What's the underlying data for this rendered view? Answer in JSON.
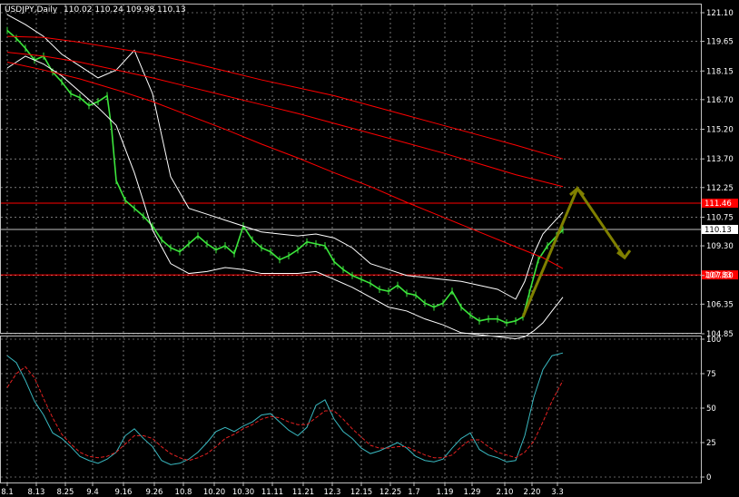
{
  "header": {
    "symbol": "USDJPY,Daily",
    "ohlc": "110.02 110.24 109.98 110.13"
  },
  "chart_data": [
    {
      "type": "line",
      "title": "USDJPY,Daily",
      "x_ticks": [
        "8.1",
        "8.13",
        "8.25",
        "9.4",
        "9.16",
        "9.26",
        "10.8",
        "10.20",
        "10.30",
        "11.11",
        "11.21",
        "12.3",
        "12.15",
        "12.25",
        "1.7",
        "1.19",
        "1.29",
        "2.10",
        "2.20",
        "3.3"
      ],
      "y_ticks": [
        "121.10",
        "119.65",
        "118.15",
        "116.70",
        "115.20",
        "113.70",
        "112.25",
        "110.75",
        "109.30",
        "107.80",
        "106.35",
        "104.85"
      ],
      "ylim": [
        104.85,
        121.1
      ],
      "price_label": "110.13",
      "horizontal_levels": [
        {
          "label": "111.46",
          "value": 111.46,
          "color": "#ff0000"
        },
        {
          "label": "107.83",
          "value": 107.83,
          "color": "#ff0000"
        },
        {
          "label": "110.13",
          "value": 110.13,
          "color": "#c0c0c0"
        }
      ],
      "series": [
        {
          "color": "#3ce63c",
          "x": [
            0,
            10,
            20,
            30,
            40,
            50,
            60,
            70,
            80,
            90,
            100,
            110,
            115,
            120,
            130,
            140,
            150,
            160,
            170,
            180,
            190,
            200,
            210,
            220,
            230,
            240,
            250,
            260,
            270,
            280,
            290,
            300,
            310,
            320,
            330,
            340,
            350,
            360,
            370,
            380,
            390,
            400,
            410,
            420,
            430,
            440,
            450,
            460,
            470,
            480,
            490,
            500,
            510,
            520,
            530,
            540,
            550,
            560,
            568,
            575,
            585,
            595,
            605,
            612
          ],
          "y": [
            120.2,
            119.8,
            119.3,
            118.7,
            118.9,
            118.1,
            117.6,
            117.0,
            116.8,
            116.4,
            116.6,
            116.9,
            115.2,
            112.6,
            111.6,
            111.2,
            110.8,
            110.3,
            109.6,
            109.2,
            109.0,
            109.4,
            109.8,
            109.4,
            109.1,
            109.3,
            108.9,
            110.3,
            109.6,
            109.2,
            109.0,
            108.6,
            108.8,
            109.1,
            109.5,
            109.4,
            109.3,
            108.5,
            108.1,
            107.8,
            107.6,
            107.4,
            107.1,
            107.0,
            107.3,
            106.9,
            106.8,
            106.4,
            106.2,
            106.4,
            107.0,
            106.2,
            105.8,
            105.5,
            105.6,
            105.6,
            105.4,
            105.5,
            105.7,
            106.9,
            108.6,
            109.3,
            109.8,
            110.1
          ]
        },
        {
          "color": "#ffffff",
          "x": [
            0,
            20,
            40,
            60,
            80,
            100,
            120,
            140,
            160,
            180,
            200,
            220,
            240,
            260,
            280,
            300,
            320,
            340,
            360,
            380,
            400,
            420,
            440,
            460,
            480,
            500,
            520,
            540,
            560,
            570,
            580,
            590,
            600,
            612
          ],
          "y": [
            121.0,
            120.5,
            119.9,
            119.0,
            118.4,
            117.8,
            118.2,
            119.2,
            117.0,
            112.8,
            111.2,
            110.9,
            110.6,
            110.3,
            110.0,
            109.9,
            109.8,
            109.9,
            109.7,
            109.2,
            108.4,
            108.1,
            107.8,
            107.7,
            107.6,
            107.5,
            107.3,
            107.1,
            106.6,
            107.5,
            108.9,
            109.9,
            110.4,
            111.0
          ]
        },
        {
          "color": "#ffffff",
          "x": [
            0,
            20,
            40,
            60,
            80,
            100,
            120,
            140,
            160,
            180,
            200,
            220,
            240,
            260,
            280,
            300,
            320,
            340,
            360,
            380,
            400,
            420,
            440,
            460,
            480,
            500,
            520,
            540,
            560,
            570,
            580,
            590,
            600,
            612
          ],
          "y": [
            118.3,
            118.9,
            118.5,
            117.9,
            117.1,
            116.3,
            115.4,
            113.0,
            110.1,
            108.4,
            107.9,
            108.0,
            108.2,
            108.1,
            107.9,
            107.9,
            107.9,
            108.0,
            107.6,
            107.2,
            106.7,
            106.2,
            106.0,
            105.6,
            105.3,
            104.9,
            104.8,
            104.7,
            104.6,
            104.7,
            105.0,
            105.4,
            106.0,
            106.7
          ]
        },
        {
          "color": "#ff0000",
          "x": [
            0,
            40,
            80,
            120,
            160,
            200,
            240,
            280,
            320,
            360,
            400,
            440,
            480,
            520,
            560,
            612
          ],
          "y": [
            119.9,
            119.85,
            119.6,
            119.3,
            119.0,
            118.6,
            118.15,
            117.7,
            117.3,
            116.9,
            116.4,
            115.9,
            115.4,
            114.9,
            114.4,
            113.7
          ]
        },
        {
          "color": "#ff0000",
          "x": [
            0,
            40,
            80,
            120,
            160,
            200,
            240,
            280,
            320,
            360,
            400,
            440,
            480,
            520,
            560,
            612
          ],
          "y": [
            119.1,
            118.9,
            118.6,
            118.2,
            117.8,
            117.35,
            116.9,
            116.45,
            116.0,
            115.5,
            115.0,
            114.5,
            114.0,
            113.45,
            112.9,
            112.3
          ]
        },
        {
          "color": "#ff0000",
          "x": [
            0,
            40,
            80,
            120,
            160,
            200,
            240,
            280,
            320,
            360,
            400,
            440,
            480,
            520,
            560,
            590,
            612
          ],
          "y": [
            118.6,
            118.2,
            117.75,
            117.2,
            116.6,
            115.9,
            115.2,
            114.45,
            113.75,
            113.0,
            112.3,
            111.5,
            110.75,
            110.0,
            109.25,
            108.7,
            108.15
          ]
        },
        {
          "color": "#808000",
          "x": [
            568,
            628,
            680
          ],
          "y": [
            105.7,
            112.2,
            108.7
          ]
        }
      ]
    },
    {
      "type": "line",
      "y_ticks": [
        "100",
        "75",
        "50",
        "25",
        "0"
      ],
      "ylim": [
        0,
        100
      ],
      "series": [
        {
          "color": "#39b8c0",
          "x": [
            0,
            10,
            20,
            30,
            40,
            50,
            60,
            70,
            80,
            90,
            100,
            110,
            120,
            130,
            140,
            150,
            160,
            170,
            180,
            190,
            200,
            210,
            220,
            230,
            240,
            250,
            260,
            270,
            280,
            290,
            300,
            310,
            320,
            330,
            340,
            350,
            360,
            370,
            380,
            390,
            400,
            410,
            420,
            430,
            440,
            450,
            460,
            470,
            480,
            490,
            500,
            510,
            520,
            530,
            540,
            550,
            560,
            570,
            580,
            590,
            600,
            612
          ],
          "y": [
            88,
            83,
            70,
            55,
            45,
            32,
            28,
            22,
            15,
            12,
            10,
            13,
            18,
            30,
            35,
            28,
            22,
            12,
            9,
            10,
            13,
            18,
            25,
            33,
            36,
            33,
            37,
            40,
            45,
            46,
            40,
            34,
            30,
            36,
            52,
            56,
            42,
            33,
            28,
            21,
            17,
            19,
            22,
            25,
            21,
            15,
            12,
            11,
            13,
            21,
            28,
            32,
            20,
            16,
            14,
            11,
            12,
            30,
            58,
            78,
            88,
            90
          ]
        },
        {
          "color": "#e32121",
          "x": [
            0,
            10,
            20,
            30,
            40,
            50,
            60,
            70,
            80,
            90,
            100,
            110,
            120,
            130,
            140,
            150,
            160,
            170,
            180,
            190,
            200,
            210,
            220,
            230,
            240,
            250,
            260,
            270,
            280,
            290,
            300,
            310,
            320,
            330,
            340,
            350,
            360,
            370,
            380,
            390,
            400,
            410,
            420,
            430,
            440,
            450,
            460,
            470,
            480,
            490,
            500,
            510,
            520,
            530,
            540,
            550,
            560,
            570,
            580,
            590,
            600,
            612
          ],
          "y": [
            65,
            75,
            80,
            72,
            57,
            43,
            31,
            24,
            18,
            15,
            14,
            15,
            18,
            24,
            30,
            30,
            28,
            22,
            17,
            14,
            12,
            14,
            17,
            22,
            28,
            31,
            35,
            38,
            42,
            44,
            43,
            40,
            38,
            38,
            43,
            48,
            48,
            42,
            35,
            29,
            23,
            21,
            21,
            22,
            22,
            19,
            16,
            14,
            14,
            16,
            22,
            27,
            27,
            22,
            18,
            16,
            14,
            18,
            26,
            40,
            55,
            70
          ]
        }
      ]
    }
  ]
}
